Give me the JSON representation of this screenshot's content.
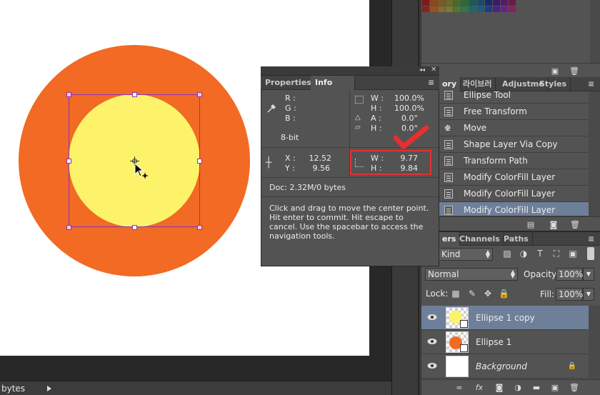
{
  "canvas": {
    "outer_circle_color": "#f26a23",
    "inner_circle_color": "#fdf36a",
    "path_color": "#8b33b3"
  },
  "status_bar": {
    "text": "bytes"
  },
  "swatches": {
    "colors": [
      "#7a1a1a",
      "#8a4a1a",
      "#7a5a2a",
      "#6a6a2a",
      "#4a6a2a",
      "#2a6a3a",
      "#1a5a5a",
      "#1a4a6a",
      "#1a2a6a",
      "#3a1a6a",
      "#5a1a6a",
      "#6a1a4a",
      "#8a2020",
      "#9a5020",
      "#8a6a30",
      "#7a7a30",
      "#4a7a30",
      "#2a7a4a",
      "#1a6a6a",
      "#1a5a8a",
      "#203a8a",
      "#4a208a",
      "#6a208a",
      "#8a2060"
    ]
  },
  "history": {
    "tabs": [
      "ory",
      "라이브러",
      "Adjustme",
      "Styles"
    ],
    "active_tab": "ory",
    "items": [
      {
        "label": "Ellipse Tool"
      },
      {
        "label": "Free Transform"
      },
      {
        "label": "Move"
      },
      {
        "label": "Shape Layer Via Copy"
      },
      {
        "label": "Transform Path"
      },
      {
        "label": "Modify ColorFill Layer"
      },
      {
        "label": "Modify ColorFill Layer"
      },
      {
        "label": "Modify ColorFill Layer"
      }
    ]
  },
  "layers": {
    "tabs": [
      "ers",
      "Channels",
      "Paths"
    ],
    "active_tab": "ers",
    "filter_kind": "Kind",
    "blend_mode": "Normal",
    "opacity_label": "Opacity:",
    "opacity_value": "100%",
    "lock_label": "Lock:",
    "fill_label": "Fill:",
    "fill_value": "100%",
    "rows": [
      {
        "name": "Ellipse 1 copy",
        "selected": true
      },
      {
        "name": "Ellipse 1",
        "selected": false
      },
      {
        "name": "Background",
        "selected": false
      }
    ],
    "footer_icons": [
      "link-icon",
      "fx-icon",
      "mask-icon",
      "adjustment-icon",
      "folder-icon",
      "new-layer-icon",
      "trash-icon"
    ]
  },
  "info_panel": {
    "tabs": [
      "Properties",
      "Info"
    ],
    "active_tab": "Info",
    "rgb": {
      "r_label": "R :",
      "g_label": "G :",
      "b_label": "B :"
    },
    "bit_depth": "8-bit",
    "transform": {
      "w_label": "W :",
      "w_value": "100.0%",
      "h_label": "H :",
      "h_value": "100.0%",
      "a_label": "A :",
      "a_value": "0.0°",
      "skew_label": "H :",
      "skew_value": "0.0°"
    },
    "position": {
      "x_label": "X :",
      "x_value": "12.52",
      "y_label": "Y :",
      "y_value": "9.56"
    },
    "size": {
      "w_label": "W :",
      "w_value": "9.77",
      "h_label": "H :",
      "h_value": "9.84"
    },
    "doc_info": "Doc: 2.32M/0 bytes",
    "help_text": "Click and drag to move the center point. Hit enter to commit. Hit escape to cancel. Use the spacebar to access the navigation tools.",
    "highlight_color": "#e53030"
  }
}
